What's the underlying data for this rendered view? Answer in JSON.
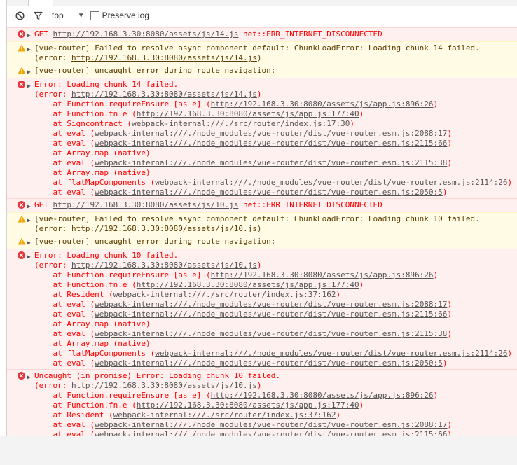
{
  "toolbar": {
    "context": "top",
    "preserve_log": "Preserve log"
  },
  "messages": [
    {
      "level": "error",
      "lines": [
        {
          "type": "get",
          "prefix": "GET ",
          "url": "http://192.168.3.30:8080/assets/js/14.js",
          "suffix": " net::ERR_INTERNET_DISCONNECTED"
        }
      ]
    },
    {
      "level": "warn",
      "lines": [
        {
          "type": "text",
          "text": "[vue-router] Failed to resolve async component default: ChunkLoadError: Loading chunk 14 failed."
        },
        {
          "type": "link",
          "prefix": "(error: ",
          "url": "http://192.168.3.30:8080/assets/js/14.js",
          "suffix": ")"
        }
      ]
    },
    {
      "level": "warn",
      "lines": [
        {
          "type": "text",
          "text": "[vue-router] uncaught error during route navigation:"
        }
      ]
    },
    {
      "level": "error",
      "lines": [
        {
          "type": "text",
          "text": "Error: Loading chunk 14 failed."
        },
        {
          "type": "link",
          "prefix": "(error: ",
          "url": "http://192.168.3.30:8080/assets/js/14.js",
          "suffix": ")"
        },
        {
          "type": "frame",
          "prefix": "at Function.requireEnsure [as e] (",
          "url": "http://192.168.3.30:8080/assets/js/app.js:896:26",
          "suffix": ")"
        },
        {
          "type": "frame",
          "prefix": "at Function.fn.e (",
          "url": "http://192.168.3.30:8080/assets/js/app.js:177:40",
          "suffix": ")"
        },
        {
          "type": "frame",
          "prefix": "at Signcontract (",
          "url": "webpack-internal:///./src/router/index.js:17:30",
          "suffix": ")"
        },
        {
          "type": "frame",
          "prefix": "at eval (",
          "url": "webpack-internal:///./node_modules/vue-router/dist/vue-router.esm.js:2088:17",
          "suffix": ")"
        },
        {
          "type": "frame",
          "prefix": "at eval (",
          "url": "webpack-internal:///./node_modules/vue-router/dist/vue-router.esm.js:2115:66",
          "suffix": ")"
        },
        {
          "type": "frametext",
          "text": "at Array.map (native)"
        },
        {
          "type": "frame",
          "prefix": "at eval (",
          "url": "webpack-internal:///./node_modules/vue-router/dist/vue-router.esm.js:2115:38",
          "suffix": ")"
        },
        {
          "type": "frametext",
          "text": "at Array.map (native)"
        },
        {
          "type": "frame",
          "prefix": "at flatMapComponents (",
          "url": "webpack-internal:///./node_modules/vue-router/dist/vue-router.esm.js:2114:26",
          "suffix": ")"
        },
        {
          "type": "frame",
          "prefix": "at eval (",
          "url": "webpack-internal:///./node_modules/vue-router/dist/vue-router.esm.js:2050:5",
          "suffix": ")"
        }
      ]
    },
    {
      "level": "error",
      "lines": [
        {
          "type": "get",
          "prefix": "GET ",
          "url": "http://192.168.3.30:8080/assets/js/10.js",
          "suffix": " net::ERR_INTERNET_DISCONNECTED"
        }
      ]
    },
    {
      "level": "warn",
      "lines": [
        {
          "type": "text",
          "text": "[vue-router] Failed to resolve async component default: ChunkLoadError: Loading chunk 10 failed."
        },
        {
          "type": "link",
          "prefix": "(error: ",
          "url": "http://192.168.3.30:8080/assets/js/10.js",
          "suffix": ")"
        }
      ]
    },
    {
      "level": "warn",
      "lines": [
        {
          "type": "text",
          "text": "[vue-router] uncaught error during route navigation:"
        }
      ]
    },
    {
      "level": "error",
      "lines": [
        {
          "type": "text",
          "text": "Error: Loading chunk 10 failed."
        },
        {
          "type": "link",
          "prefix": "(error: ",
          "url": "http://192.168.3.30:8080/assets/js/10.js",
          "suffix": ")"
        },
        {
          "type": "frame",
          "prefix": "at Function.requireEnsure [as e] (",
          "url": "http://192.168.3.30:8080/assets/js/app.js:896:26",
          "suffix": ")"
        },
        {
          "type": "frame",
          "prefix": "at Function.fn.e (",
          "url": "http://192.168.3.30:8080/assets/js/app.js:177:40",
          "suffix": ")"
        },
        {
          "type": "frame",
          "prefix": "at Resident (",
          "url": "webpack-internal:///./src/router/index.js:37:162",
          "suffix": ")"
        },
        {
          "type": "frame",
          "prefix": "at eval (",
          "url": "webpack-internal:///./node_modules/vue-router/dist/vue-router.esm.js:2088:17",
          "suffix": ")"
        },
        {
          "type": "frame",
          "prefix": "at eval (",
          "url": "webpack-internal:///./node_modules/vue-router/dist/vue-router.esm.js:2115:66",
          "suffix": ")"
        },
        {
          "type": "frametext",
          "text": "at Array.map (native)"
        },
        {
          "type": "frame",
          "prefix": "at eval (",
          "url": "webpack-internal:///./node_modules/vue-router/dist/vue-router.esm.js:2115:38",
          "suffix": ")"
        },
        {
          "type": "frametext",
          "text": "at Array.map (native)"
        },
        {
          "type": "frame",
          "prefix": "at flatMapComponents (",
          "url": "webpack-internal:///./node_modules/vue-router/dist/vue-router.esm.js:2114:26",
          "suffix": ")"
        },
        {
          "type": "frame",
          "prefix": "at eval (",
          "url": "webpack-internal:///./node_modules/vue-router/dist/vue-router.esm.js:2050:5",
          "suffix": ")"
        }
      ]
    },
    {
      "level": "error",
      "lines": [
        {
          "type": "text",
          "text": "Uncaught (in promise) Error: Loading chunk 10 failed."
        },
        {
          "type": "link",
          "prefix": "(error: ",
          "url": "http://192.168.3.30:8080/assets/js/10.js",
          "suffix": ")"
        },
        {
          "type": "frame",
          "prefix": "at Function.requireEnsure [as e] (",
          "url": "http://192.168.3.30:8080/assets/js/app.js:896:26",
          "suffix": ")"
        },
        {
          "type": "frame",
          "prefix": "at Function.fn.e (",
          "url": "http://192.168.3.30:8080/assets/js/app.js:177:40",
          "suffix": ")"
        },
        {
          "type": "frame",
          "prefix": "at Resident (",
          "url": "webpack-internal:///./src/router/index.js:37:162",
          "suffix": ")"
        },
        {
          "type": "frame",
          "prefix": "at eval (",
          "url": "webpack-internal:///./node_modules/vue-router/dist/vue-router.esm.js:2088:17",
          "suffix": ")"
        },
        {
          "type": "frame",
          "prefix": "at eval (",
          "url": "webpack-internal:///./node_modules/vue-router/dist/vue-router.esm.js:2115:66",
          "suffix": ")"
        }
      ]
    }
  ]
}
